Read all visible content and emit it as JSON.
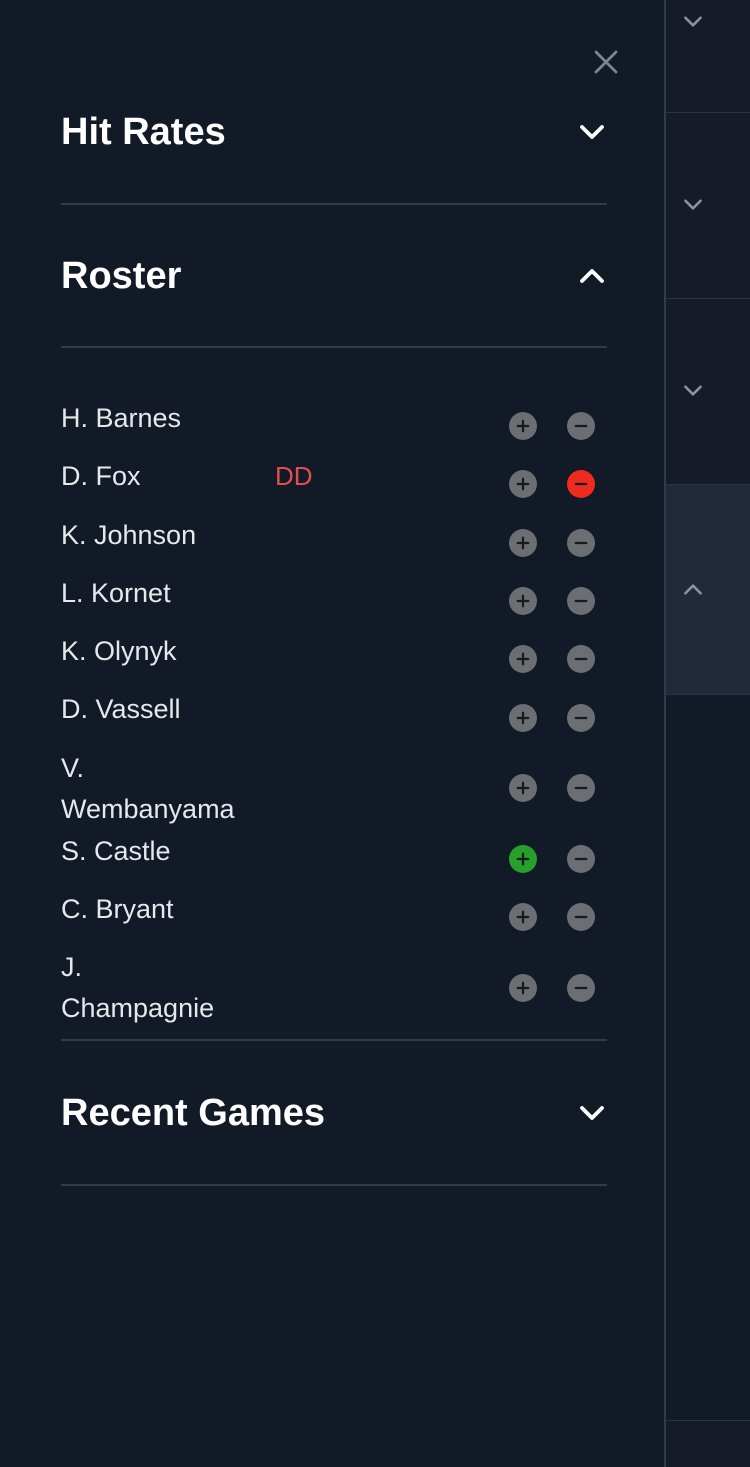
{
  "drawer": {
    "close_icon": "close-icon",
    "sections": {
      "hit_rates": {
        "title": "Hit Rates",
        "state": "collapsed"
      },
      "roster": {
        "title": "Roster",
        "state": "expanded"
      },
      "recent_games": {
        "title": "Recent Games",
        "state": "collapsed"
      }
    },
    "roster": [
      {
        "name": "H. Barnes",
        "tag": "",
        "plus": "neutral",
        "minus": "neutral"
      },
      {
        "name": "D. Fox",
        "tag": "DD",
        "plus": "neutral",
        "minus": "active-red"
      },
      {
        "name": "K. Johnson",
        "tag": "",
        "plus": "neutral",
        "minus": "neutral"
      },
      {
        "name": "L. Kornet",
        "tag": "",
        "plus": "neutral",
        "minus": "neutral"
      },
      {
        "name": "K. Olynyk",
        "tag": "",
        "plus": "neutral",
        "minus": "neutral"
      },
      {
        "name": "D. Vassell",
        "tag": "",
        "plus": "neutral",
        "minus": "neutral"
      },
      {
        "name": "V. Wembanyama",
        "tag": "",
        "plus": "neutral",
        "minus": "neutral"
      },
      {
        "name": "S. Castle",
        "tag": "",
        "plus": "active-green",
        "minus": "neutral"
      },
      {
        "name": "C. Bryant",
        "tag": "",
        "plus": "neutral",
        "minus": "neutral"
      },
      {
        "name": "J. Champagnie",
        "tag": "",
        "plus": "neutral",
        "minus": "neutral"
      }
    ]
  },
  "colors": {
    "drawer_bg": "#121a27",
    "tag_red": "#e04f4f",
    "minus_active": "#ee2b1e",
    "plus_active": "#27a02b",
    "button_neutral": "#6b6e73"
  }
}
